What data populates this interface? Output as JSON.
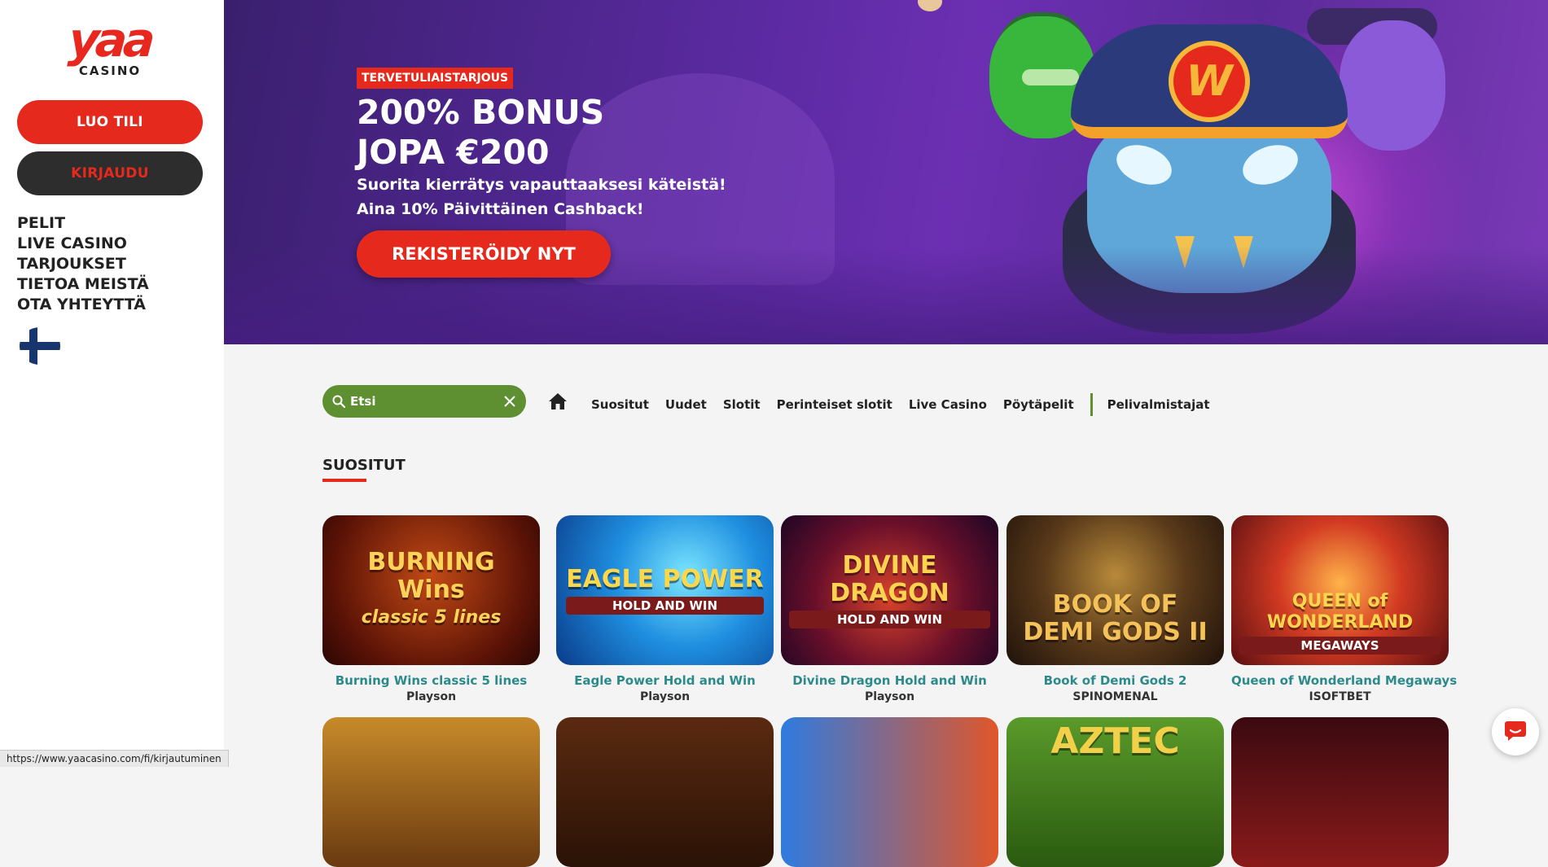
{
  "sidebar": {
    "logo_text": "yaa",
    "logo_sub": "CASINO",
    "register_label": "LUO TILI",
    "login_label": "KIRJAUDU",
    "nav": [
      "PELIT",
      "LIVE CASINO",
      "TARJOUKSET",
      "TIETOA MEISTÄ",
      "OTA YHTEYTTÄ"
    ],
    "language_icon": "finland-flag-icon"
  },
  "hero": {
    "tag": "TERVETULIAISTARJOUS",
    "title_line1": "200% BONUS",
    "title_line2": "JOPA €200",
    "sub_line1": "Suorita kierrätys vapauttaaksesi käteistä!",
    "sub_line2": "Aina 10% Päivittäinen Cashback!",
    "cta_label": "REKISTERÖIDY NYT",
    "badge_letter": "W"
  },
  "search": {
    "placeholder": "Etsi"
  },
  "categories": [
    "Suositut",
    "Uudet",
    "Slotit",
    "Perinteiset slotit",
    "Live Casino",
    "Pöytäpelit"
  ],
  "providers_label": "Pelivalmistajat",
  "section": {
    "title": "SUOSITUT"
  },
  "games": [
    {
      "name": "Burning Wins classic 5 lines",
      "provider": "Playson",
      "art_line1": "BURNING Wins",
      "art_line2": "classic 5 lines"
    },
    {
      "name": "Eagle Power Hold and Win",
      "provider": "Playson",
      "art_line1": "EAGLE POWER",
      "art_line2": "HOLD AND WIN"
    },
    {
      "name": "Divine Dragon Hold and Win",
      "provider": "Playson",
      "art_line1": "DIVINE DRAGON",
      "art_line2": "HOLD AND WIN"
    },
    {
      "name": "Book of Demi Gods 2",
      "provider": "SPINOMENAL",
      "art_line1": "BOOK OF",
      "art_line2": "DEMI GODS II"
    },
    {
      "name": "Queen of Wonderland Megaways",
      "provider": "ISOFTBET",
      "art_line1": "QUEEN of WONDERLAND",
      "art_line2": "MEGAWAYS"
    }
  ],
  "row2_art": [
    "",
    "",
    "",
    "AZTEC",
    ""
  ],
  "status_bar": {
    "url": "https://www.yaacasino.com/fi/kirjautuminen"
  },
  "colors": {
    "brand_red": "#e6291d",
    "search_green": "#5e8f31",
    "game_title_teal": "#2c8a8a",
    "dark_button": "#2d2d2d"
  }
}
